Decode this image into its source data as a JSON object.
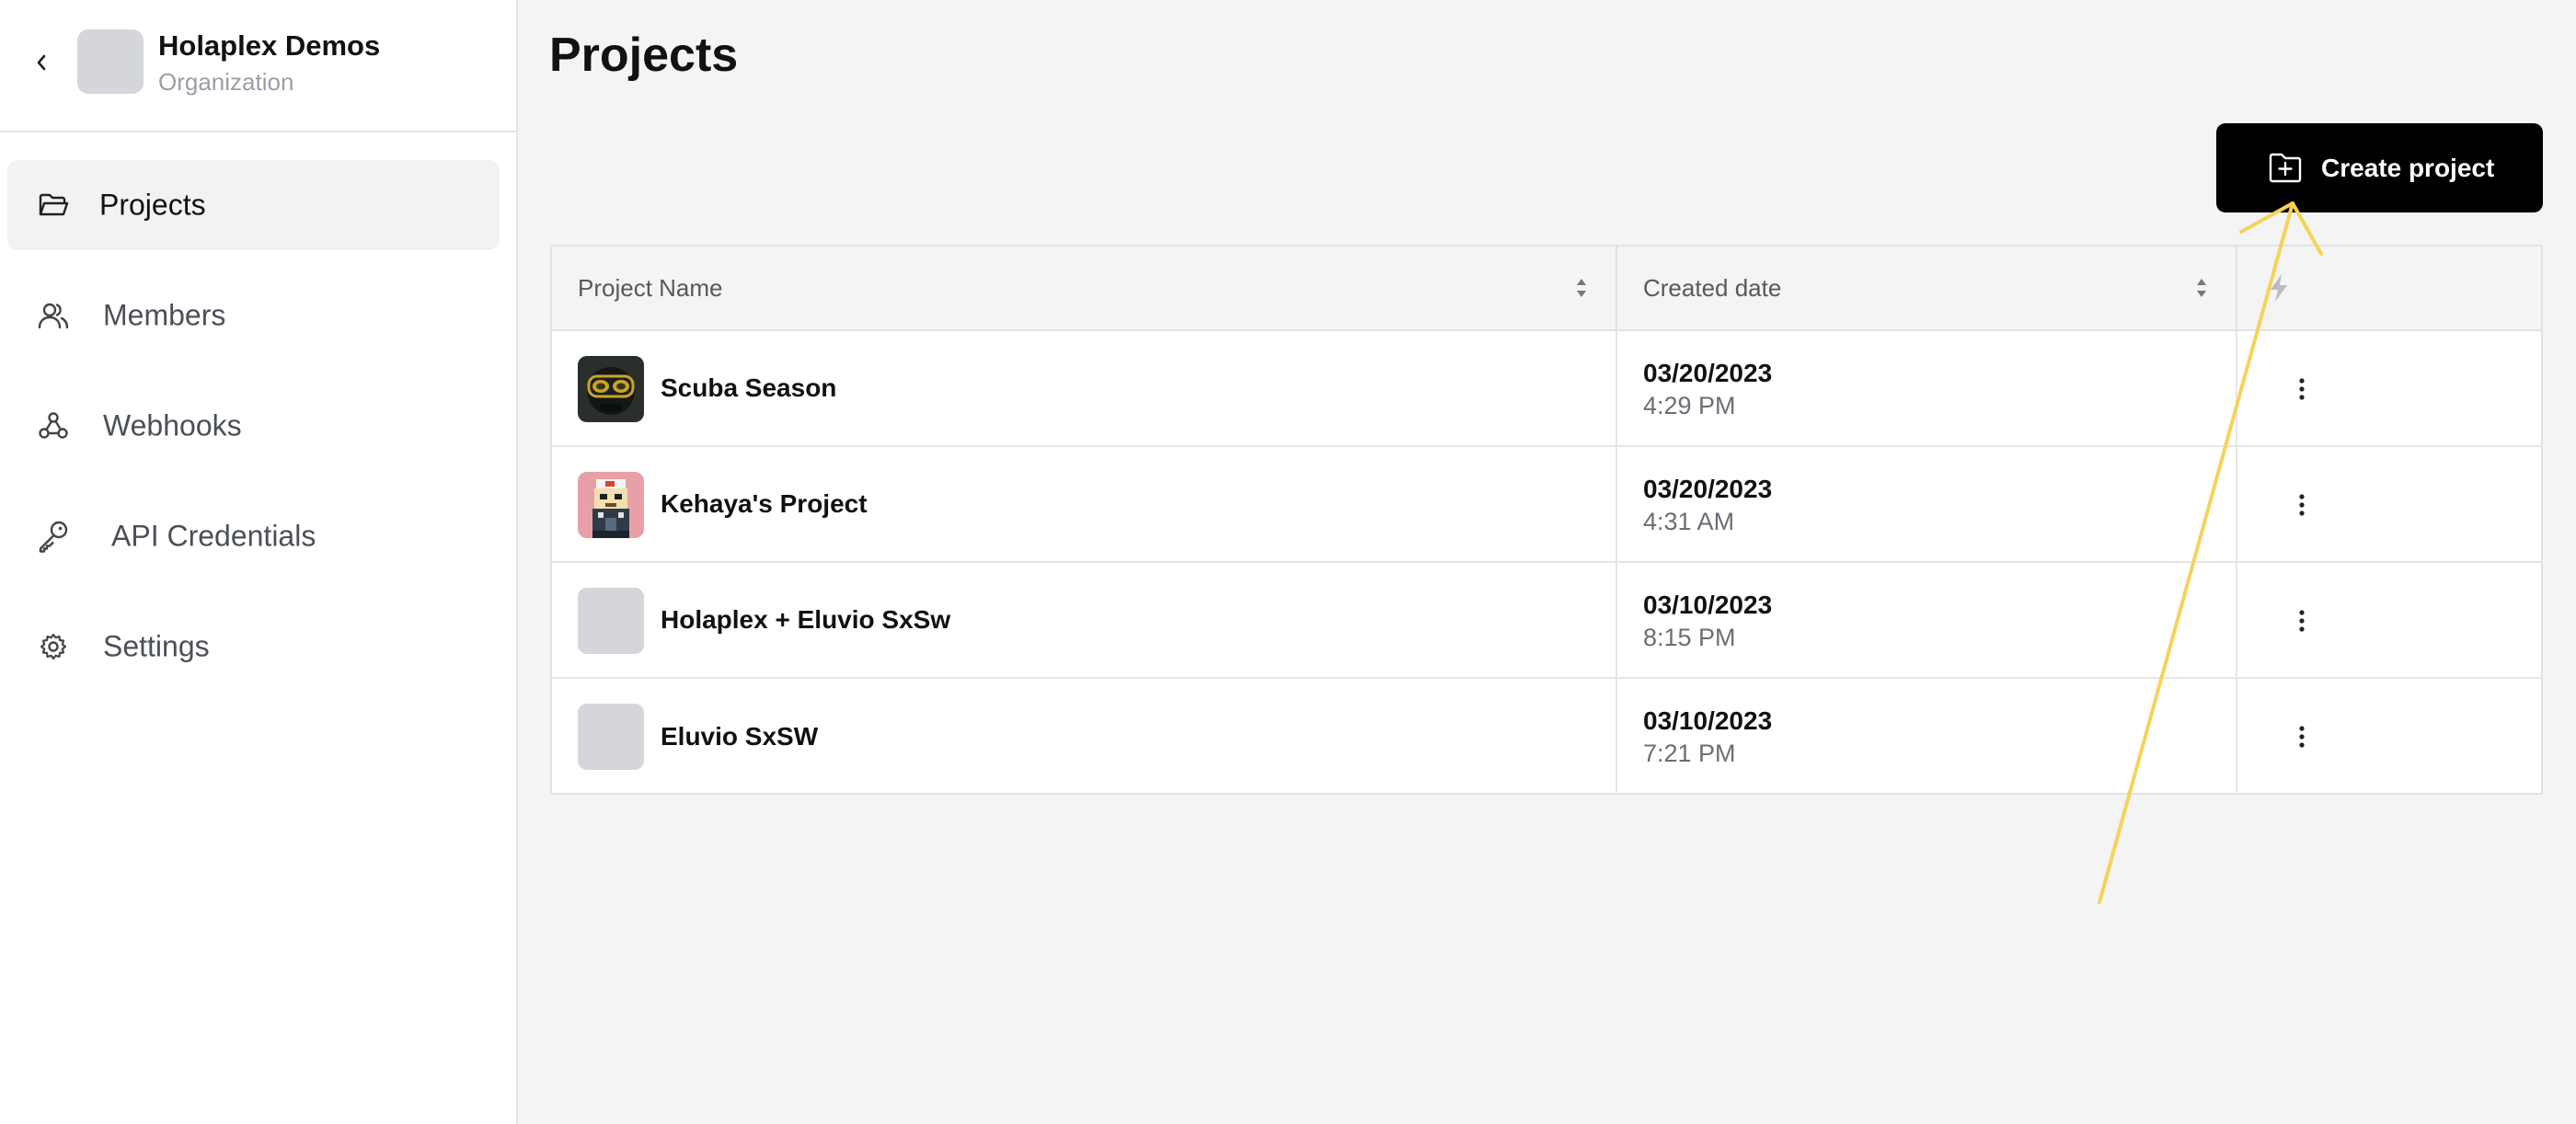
{
  "sidebar": {
    "org_name": "Holaplex Demos",
    "org_role": "Organization",
    "items": [
      {
        "label": "Projects",
        "icon": "folder-open-icon",
        "active": true
      },
      {
        "label": "Members",
        "icon": "users-icon",
        "active": false
      },
      {
        "label": "Webhooks",
        "icon": "webhook-icon",
        "active": false
      },
      {
        "label": "API Credentials",
        "icon": "key-icon",
        "active": false
      },
      {
        "label": "Settings",
        "icon": "gear-icon",
        "active": false
      }
    ]
  },
  "main": {
    "title": "Projects",
    "create_button": "Create project",
    "table": {
      "columns": [
        "Project Name",
        "Created date",
        ""
      ],
      "rows": [
        {
          "name": "Scuba Season",
          "date": "03/20/2023",
          "time": "4:29 PM",
          "thumbnail": "diver-image"
        },
        {
          "name": "Kehaya's Project",
          "date": "03/20/2023",
          "time": "4:31 AM",
          "thumbnail": "pixel-character-image"
        },
        {
          "name": "Holaplex + Eluvio SxSw",
          "date": "03/10/2023",
          "time": "8:15 PM",
          "thumbnail": "placeholder"
        },
        {
          "name": "Eluvio SxSW",
          "date": "03/10/2023",
          "time": "7:21 PM",
          "thumbnail": "placeholder"
        }
      ]
    }
  },
  "colors": {
    "accent": "#000000",
    "sidebar_active_bg": "#f2f2f2",
    "page_bg": "#f4f4f4",
    "annotation_arrow": "#f5d35a"
  }
}
